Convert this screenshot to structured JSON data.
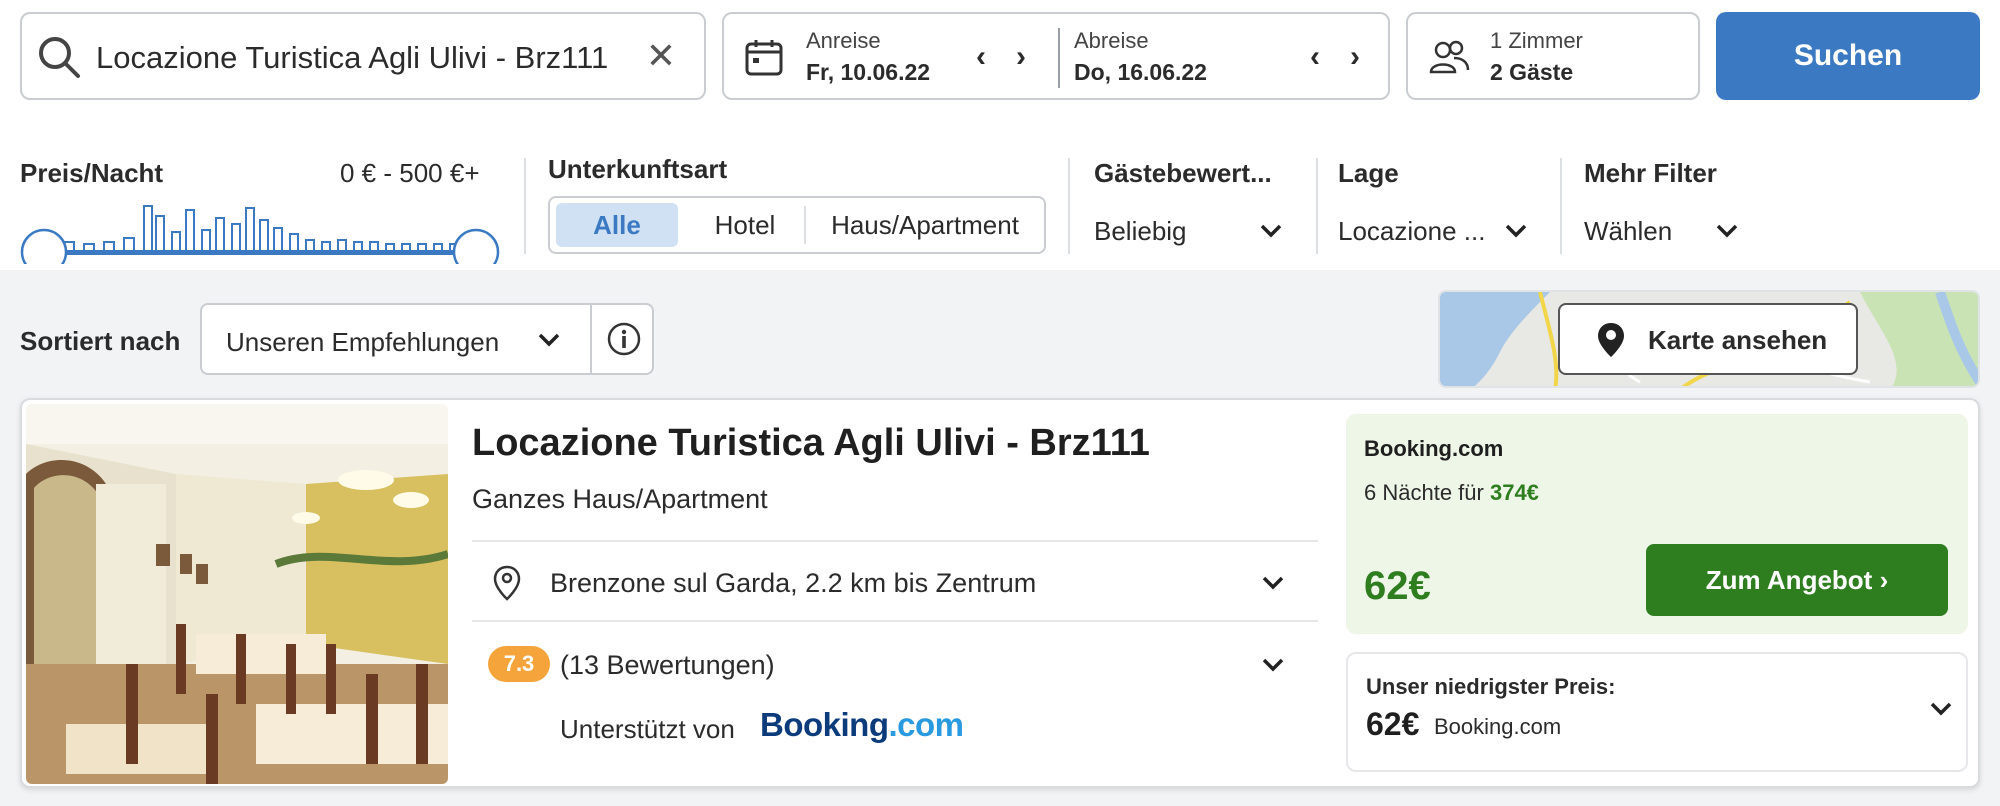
{
  "search": {
    "query": "Locazione Turistica Agli Ulivi - Brz111",
    "clear_icon": "close-icon"
  },
  "dates": {
    "arrival_label": "Anreise",
    "arrival_value": "Fr, 10.06.22",
    "departure_label": "Abreise",
    "departure_value": "Do, 16.06.22"
  },
  "guests": {
    "rooms": "1 Zimmer",
    "guests": "2 Gäste"
  },
  "search_button": "Suchen",
  "filters": {
    "price_title": "Preis/Nacht",
    "price_range": "0 € - 500 €+",
    "type_title": "Unterkunftsart",
    "type_options": [
      "Alle",
      "Hotel",
      "Haus/Apartment"
    ],
    "type_selected": "Alle",
    "rating_title": "Gästebewert...",
    "rating_value": "Beliebig",
    "location_title": "Lage",
    "location_value": "Locazione ...",
    "more_title": "Mehr Filter",
    "more_value": "Wählen"
  },
  "sort": {
    "label": "Sortiert nach",
    "value": "Unseren Empfehlungen"
  },
  "map_button": "Karte ansehen",
  "result": {
    "title": "Locazione Turistica Agli Ulivi - Brz111",
    "subtitle": "Ganzes Haus/Apartment",
    "location": "Brenzone sul Garda, 2.2 km bis Zentrum",
    "rating": "7.3",
    "reviews": "(13 Bewertungen)",
    "supported_by": "Unterstützt von",
    "brand_a": "Booking",
    "brand_b": ".com",
    "offer": {
      "provider": "Booking.com",
      "nights_text": "6 Nächte für",
      "nights_price": "374€",
      "price": "62€",
      "cta": "Zum Angebot"
    },
    "lowest": {
      "title": "Unser niedrigster Preis:",
      "price": "62€",
      "provider": "Booking.com"
    }
  },
  "colors": {
    "primary": "#3b7ac3",
    "offer_green": "#2e7d1f",
    "offer_bg": "#eef6e8",
    "rating_badge": "#f5a43c"
  }
}
